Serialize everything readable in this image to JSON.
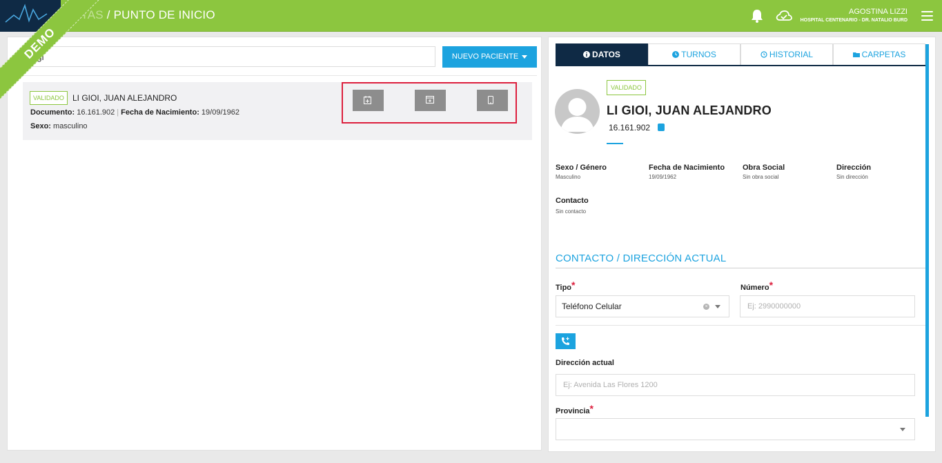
{
  "header": {
    "title_faded": "CITAS",
    "title_main": " / PUNTO DE INICIO",
    "user_name": "AGOSTINA LIZZI",
    "hospital": "HOSPITAL CENTENARIO - DR. NATALIO BURD",
    "ribbon": "DEMO",
    "accent": "#8cc63f",
    "dark": "#0f2a45"
  },
  "search": {
    "value": "li gi",
    "new_patient_label": "NUEVO PACIENTE"
  },
  "patient_row": {
    "badge": "VALIDADO",
    "name": "LI GIOI, JUAN ALEJANDRO",
    "doc_label": "Documento:",
    "doc_value": "16.161.902",
    "birth_label": "Fecha de Nacimiento:",
    "birth_value": "19/09/1962",
    "sex_label": "Sexo:",
    "sex_value": "masculino",
    "actions": [
      "calendar-add-icon",
      "calendar-checkin-icon",
      "mobile-icon"
    ]
  },
  "detail": {
    "tabs": [
      "DATOS",
      "TURNOS",
      "HISTORIAL",
      "CARPETAS"
    ],
    "badge": "VALIDADO",
    "name": "LI GIOI, JUAN ALEJANDRO",
    "document": "16.161.902",
    "info": [
      {
        "label": "Sexo / Género",
        "value": "Masculino"
      },
      {
        "label": "Fecha de Nacimiento",
        "value": "19/09/1962"
      },
      {
        "label": "Obra Social",
        "value": "Sin obra social"
      },
      {
        "label": "Dirección",
        "value": "Sin dirección"
      },
      {
        "label": "Contacto",
        "value": "Sin contacto"
      }
    ],
    "section_title": "CONTACTO / DIRECCIÓN ACTUAL",
    "tipo_label": "Tipo",
    "tipo_value": "Teléfono Celular",
    "numero_label": "Número",
    "numero_placeholder": "Ej: 2990000000",
    "direccion_label": "Dirección actual",
    "direccion_placeholder": "Ej: Avenida Las Flores 1200",
    "provincia_label": "Provincia",
    "required_mark": "*"
  }
}
